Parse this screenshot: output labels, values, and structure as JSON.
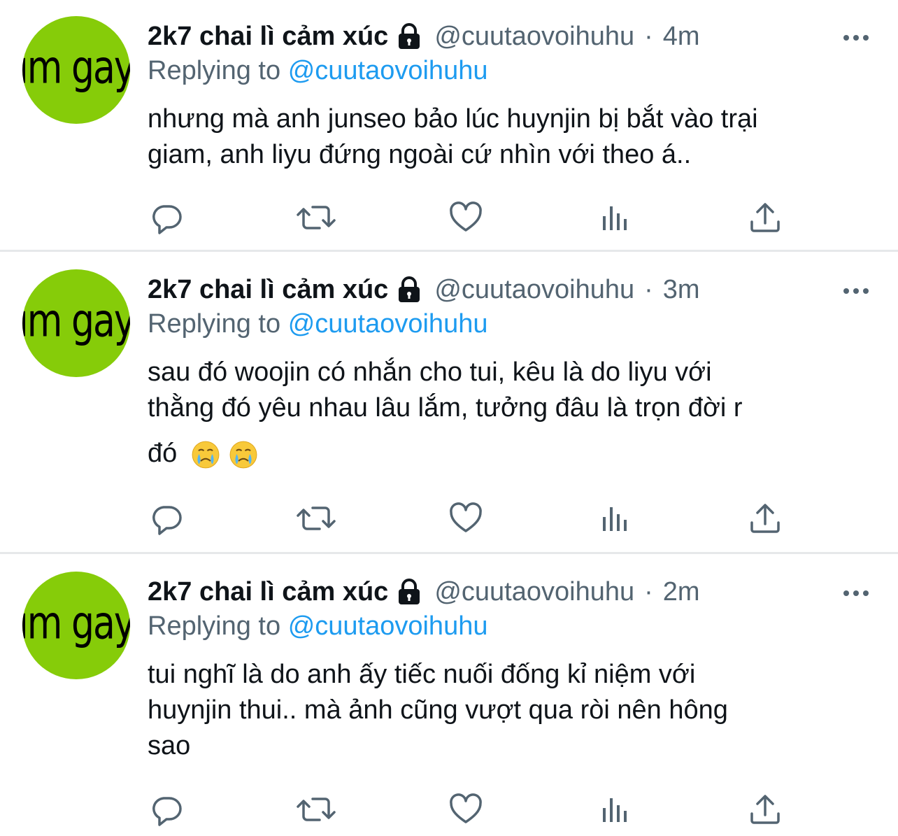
{
  "colors": {
    "accent": "#1d9bf0",
    "muted": "#536471",
    "text": "#0f1419",
    "avatar_bg": "#86cc09",
    "divider": "#e6e8ea"
  },
  "tweets": [
    {
      "avatar_text": "im gay",
      "display_name": "2k7 chai lì cảm xúc",
      "handle": "@cuutaovoihuhu",
      "time": "4m",
      "replying_label": "Replying to",
      "replying_handle": "@cuutaovoihuhu",
      "text_lines": [
        "nhưng mà anh junseo bảo lúc huynjin bị bắt vào trại",
        "giam, anh liyu đứng ngoài cứ nhìn với theo á.."
      ],
      "icons": [
        "reply-icon",
        "retweet-icon",
        "like-icon",
        "analytics-icon",
        "share-icon"
      ]
    },
    {
      "avatar_text": "im gay",
      "display_name": "2k7 chai lì cảm xúc",
      "handle": "@cuutaovoihuhu",
      "time": "3m",
      "replying_label": "Replying to",
      "replying_handle": "@cuutaovoihuhu",
      "text_lines": [
        "sau đó woojin có nhắn cho tui, kêu là do liyu với",
        "thằng đó yêu nhau lâu lắm, tưởng đâu là trọn đời r",
        "đó"
      ],
      "emojis": [
        "crying-face-icon",
        "crying-face-icon"
      ],
      "icons": [
        "reply-icon",
        "retweet-icon",
        "like-icon",
        "analytics-icon",
        "share-icon"
      ]
    },
    {
      "avatar_text": "im gay",
      "display_name": "2k7 chai lì cảm xúc",
      "handle": "@cuutaovoihuhu",
      "time": "2m",
      "replying_label": "Replying to",
      "replying_handle": "@cuutaovoihuhu",
      "text_lines": [
        "tui nghĩ là do anh ấy tiếc nuối đống kỉ niệm với",
        "huynjin thui.. mà ảnh cũng vượt qua ròi nên hông",
        "sao"
      ],
      "icons": [
        "reply-icon",
        "retweet-icon",
        "like-icon",
        "analytics-icon",
        "share-icon"
      ]
    }
  ]
}
